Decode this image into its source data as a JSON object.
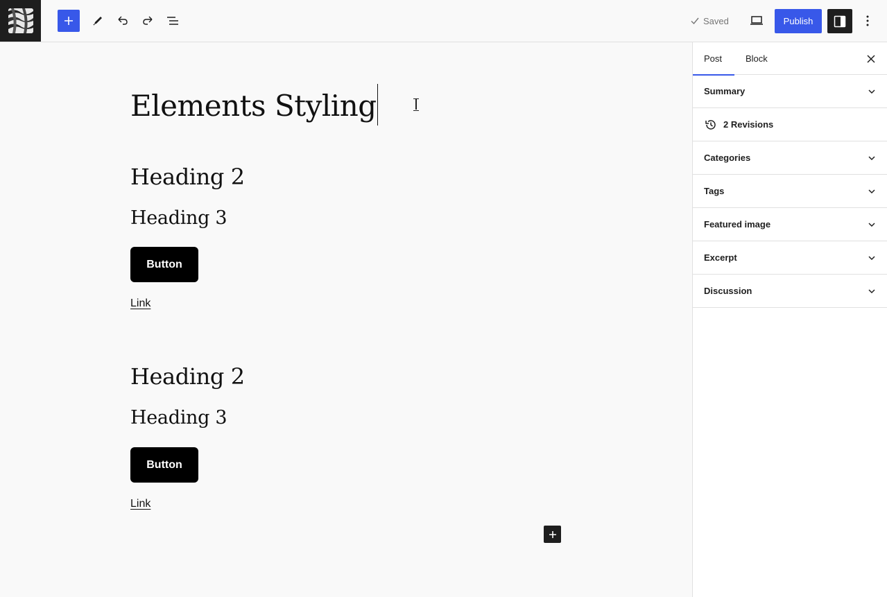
{
  "topbar": {
    "saved_label": "Saved",
    "publish_label": "Publish"
  },
  "post": {
    "title": "Elements Styling",
    "groups": [
      {
        "heading2": "Heading 2",
        "heading3": "Heading 3",
        "button": "Button",
        "link": "Link"
      },
      {
        "heading2": "Heading 2",
        "heading3": "Heading 3",
        "button": "Button",
        "link": "Link"
      }
    ]
  },
  "sidebar": {
    "tabs": [
      {
        "label": "Post",
        "active": true
      },
      {
        "label": "Block",
        "active": false
      }
    ],
    "panels": [
      {
        "label": "Summary",
        "icon": "chevron-down-icon"
      },
      {
        "label": "2 Revisions",
        "icon": "history-icon"
      },
      {
        "label": "Categories",
        "icon": "chevron-down-icon"
      },
      {
        "label": "Tags",
        "icon": "chevron-down-icon"
      },
      {
        "label": "Featured image",
        "icon": "chevron-down-icon"
      },
      {
        "label": "Excerpt",
        "icon": "chevron-down-icon"
      },
      {
        "label": "Discussion",
        "icon": "chevron-down-icon"
      }
    ]
  },
  "colors": {
    "accent": "#3858e9",
    "dark": "#1e1e1e",
    "canvas": "#f9f9f9"
  }
}
